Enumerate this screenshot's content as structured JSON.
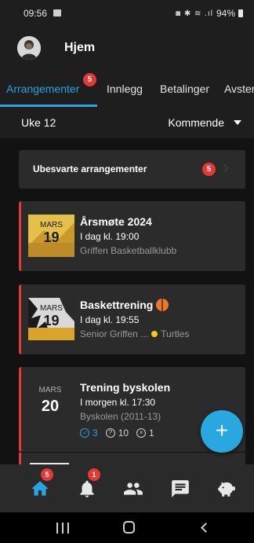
{
  "status_bar": {
    "time": "09:56",
    "system_icons": "◙ ✱ ≋ .ıl",
    "battery": "94%"
  },
  "top_bar": {
    "title": "Hjem"
  },
  "tabs": [
    {
      "label": "Arrangementer",
      "active": true,
      "badge": "5"
    },
    {
      "label": "Innlegg",
      "active": false
    },
    {
      "label": "Betalinger",
      "active": false
    },
    {
      "label": "Avster",
      "active": false
    }
  ],
  "filter": {
    "week": "Uke 12",
    "selected": "Kommende"
  },
  "unanswered": {
    "label": "Ubesvarte arrangementer",
    "badge": "5"
  },
  "events": [
    {
      "month": "MARS",
      "day": "19",
      "title": "Årsmøte 2024",
      "time": "I dag kl. 19:00",
      "subtitle": "Griffen Basketballklubb"
    },
    {
      "month": "MARS",
      "day": "19",
      "title": "Baskettrening",
      "title_icon": "basketball-icon",
      "time": "I dag kl. 19:55",
      "subtitle": "Senior Griffen ...",
      "group": "Turtles"
    },
    {
      "month": "MARS",
      "day": "20",
      "title": "Trening byskolen",
      "time": "I morgen kl. 17:30",
      "subtitle": "Byskolen (2011-13)",
      "rsvp": {
        "yes": "3",
        "unknown": "10",
        "no": "1"
      }
    }
  ],
  "fab": {
    "label": "+"
  },
  "bottom_nav": {
    "home_badge": "5",
    "notifications_badge": "1"
  },
  "colors": {
    "accent": "#2aa3e0",
    "badge": "#e53935",
    "background": "#121212",
    "card": "#2b2b2b"
  }
}
